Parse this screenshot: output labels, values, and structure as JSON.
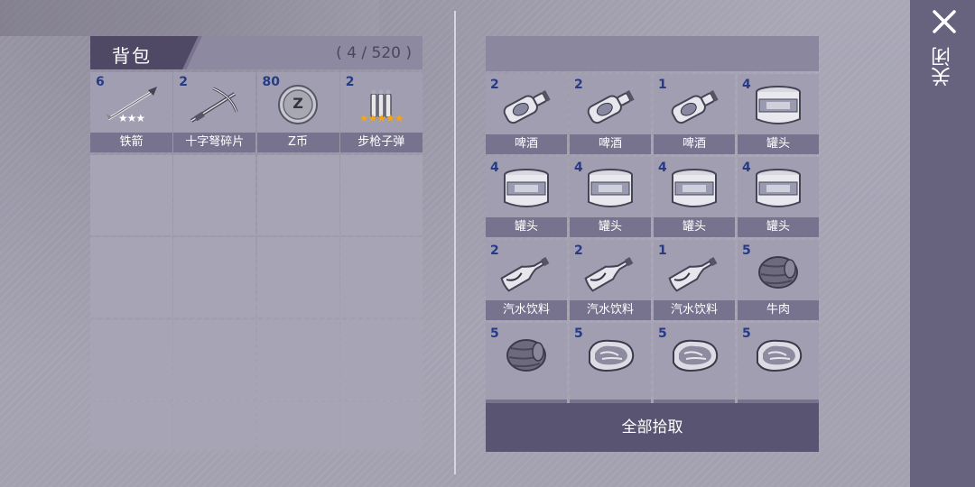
{
  "backpack": {
    "title": "背包",
    "count": "( 4 / 520 )",
    "items": [
      {
        "qty": "6",
        "name": "铁箭",
        "icon": "arrow-icon",
        "stars": "★★★",
        "star_color": "#ffffff"
      },
      {
        "qty": "2",
        "name": "十字弩碎片",
        "icon": "crossbow-icon",
        "stars": "",
        "star_color": "#ffffff"
      },
      {
        "qty": "80",
        "name": "Z币",
        "icon": "z-coin-icon",
        "stars": "",
        "star_color": "#ffffff"
      },
      {
        "qty": "2",
        "name": "步枪子弹",
        "icon": "rifle-bullets-icon",
        "stars": "★★★★★",
        "star_color": "#f2a516"
      }
    ]
  },
  "loot": {
    "items": [
      {
        "qty": "2",
        "name": "啤酒",
        "icon": "beer-bottle-icon"
      },
      {
        "qty": "2",
        "name": "啤酒",
        "icon": "beer-bottle-icon"
      },
      {
        "qty": "1",
        "name": "啤酒",
        "icon": "beer-bottle-icon"
      },
      {
        "qty": "4",
        "name": "罐头",
        "icon": "canned-food-icon"
      },
      {
        "qty": "4",
        "name": "罐头",
        "icon": "canned-food-icon"
      },
      {
        "qty": "4",
        "name": "罐头",
        "icon": "canned-food-icon"
      },
      {
        "qty": "4",
        "name": "罐头",
        "icon": "canned-food-icon"
      },
      {
        "qty": "4",
        "name": "罐头",
        "icon": "canned-food-icon"
      },
      {
        "qty": "2",
        "name": "汽水饮料",
        "icon": "soda-bottle-icon"
      },
      {
        "qty": "2",
        "name": "汽水饮料",
        "icon": "soda-bottle-icon"
      },
      {
        "qty": "1",
        "name": "汽水饮料",
        "icon": "soda-bottle-icon"
      },
      {
        "qty": "5",
        "name": "牛肉",
        "icon": "beef-icon"
      },
      {
        "qty": "5",
        "name": "",
        "icon": "beef-icon"
      },
      {
        "qty": "5",
        "name": "",
        "icon": "steak-icon"
      },
      {
        "qty": "5",
        "name": "",
        "icon": "steak-icon"
      },
      {
        "qty": "5",
        "name": "",
        "icon": "steak-icon"
      }
    ],
    "pickup_all_label": "全部拾取"
  },
  "close": {
    "label": "关闭"
  },
  "colors": {
    "qty_text": "#263a86",
    "name_bar": "#77728d",
    "button_bg": "#5a5473"
  }
}
